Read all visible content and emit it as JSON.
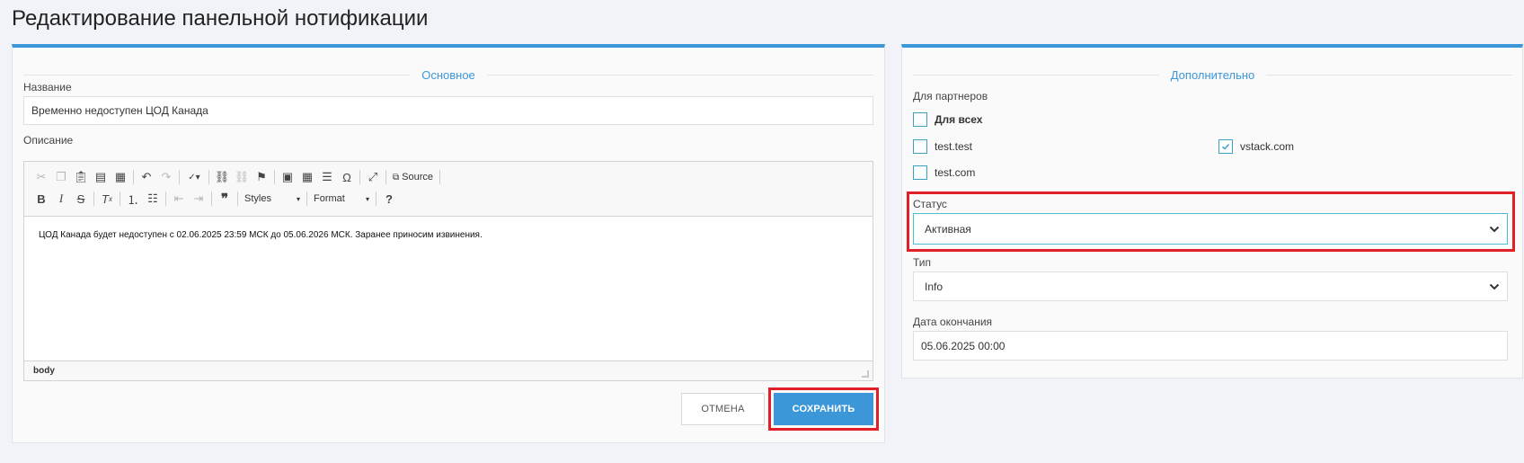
{
  "page": {
    "title": "Редактирование панельной нотификации"
  },
  "main": {
    "section_title": "Основное",
    "name_label": "Название",
    "name_value": "Временно недоступен ЦОД Канада",
    "description_label": "Описание",
    "editor": {
      "source_label": "Source",
      "styles_label": "Styles",
      "format_label": "Format",
      "content": "ЦОД Канада будет недоступен с 02.06.2025 23:59 МСК до 05.06.2026 МСК. Заранее приносим извинения.",
      "path": "body"
    },
    "cancel_label": "ОТМЕНА",
    "save_label": "СОХРАНИТЬ"
  },
  "extra": {
    "section_title": "Дополнительно",
    "partners_label": "Для партнеров",
    "partners": [
      {
        "label": "Для всех",
        "checked": false,
        "bold": true
      },
      {
        "label": "test.test",
        "checked": false
      },
      {
        "label": "vstack.com",
        "checked": true
      },
      {
        "label": "test.com",
        "checked": false
      }
    ],
    "status_label": "Статус",
    "status_value": "Активная",
    "type_label": "Тип",
    "type_value": "Info",
    "end_date_label": "Дата окончания",
    "end_date_value": "05.06.2025 00:00"
  },
  "colors": {
    "accent": "#3c97d9",
    "highlight": "#e01f27",
    "checkbox": "#3ba2c6"
  }
}
